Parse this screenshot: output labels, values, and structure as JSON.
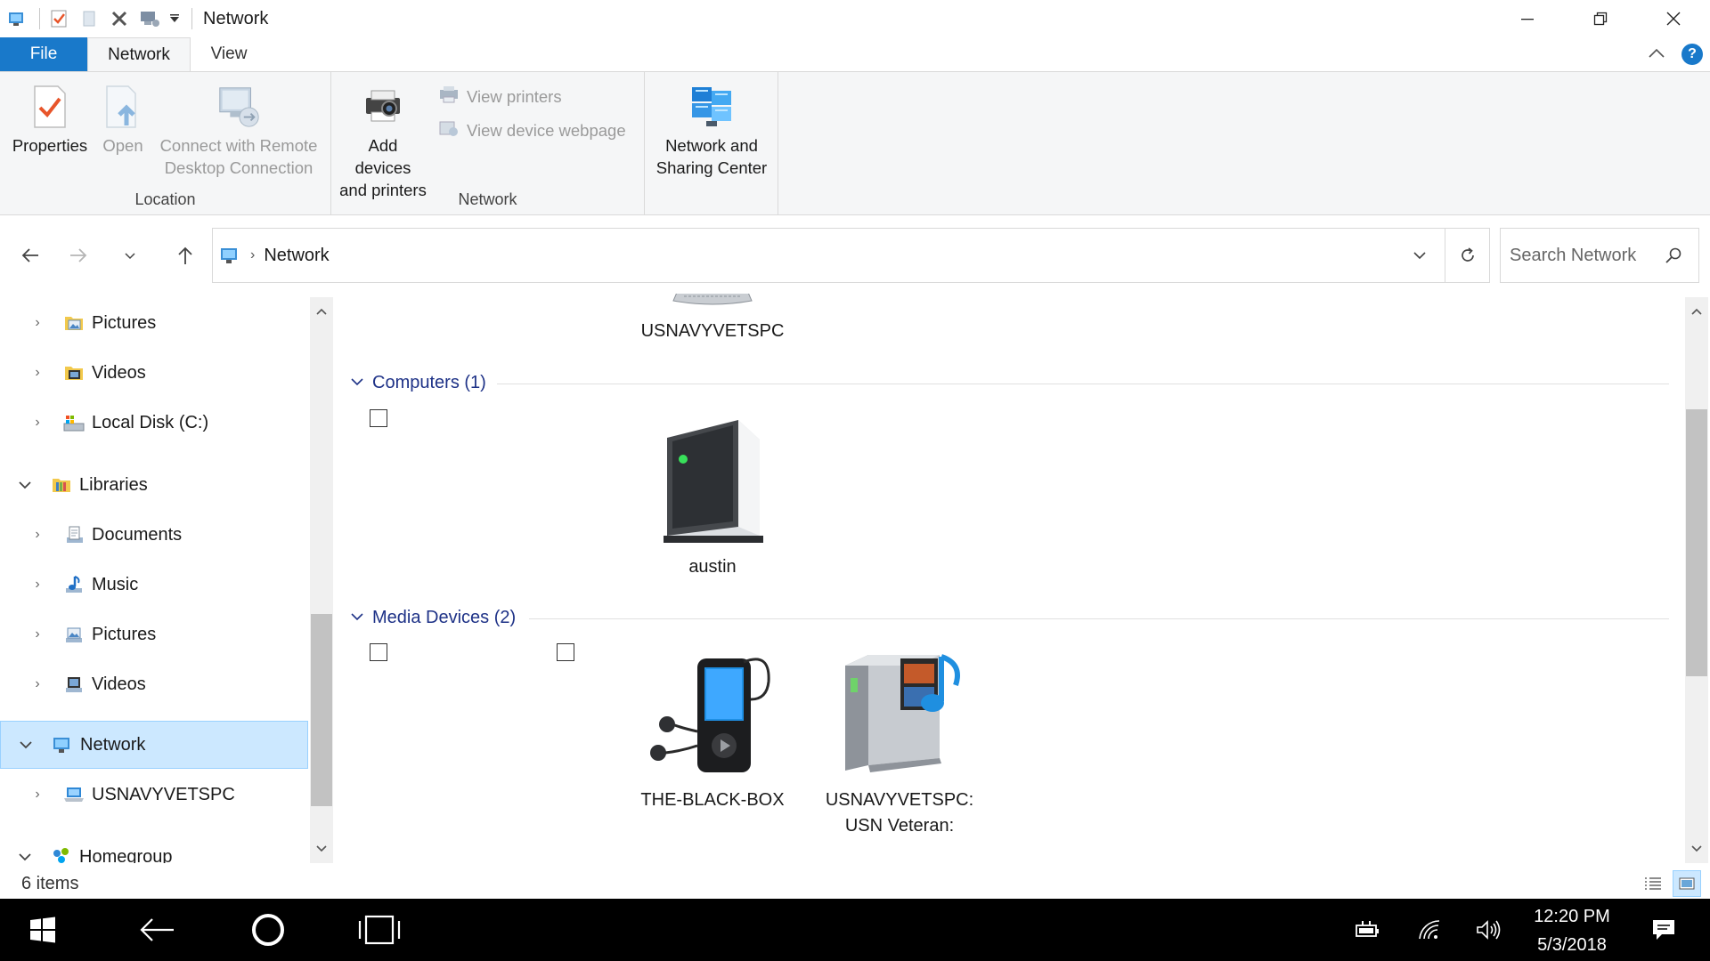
{
  "window": {
    "title": "Network"
  },
  "ribbon_tabs": {
    "file": "File",
    "network": "Network",
    "view": "View"
  },
  "ribbon": {
    "location_group": {
      "label": "Location",
      "properties": "Properties",
      "open": "Open",
      "remote_line1": "Connect with Remote",
      "remote_line2": "Desktop Connection"
    },
    "network_group": {
      "label": "Network",
      "add_devices_line1": "Add devices",
      "add_devices_line2": "and printers",
      "view_printers": "View printers",
      "view_device_webpage": "View device webpage"
    },
    "center_group": {
      "nsc_line1": "Network and",
      "nsc_line2": "Sharing Center"
    }
  },
  "address": {
    "crumb": "Network",
    "search_placeholder": "Search Network"
  },
  "nav": {
    "items": [
      {
        "label": "Pictures"
      },
      {
        "label": "Videos"
      },
      {
        "label": "Local Disk (C:)"
      },
      {
        "label": "Libraries"
      },
      {
        "label": "Documents"
      },
      {
        "label": "Music"
      },
      {
        "label": "Pictures"
      },
      {
        "label": "Videos"
      },
      {
        "label": "Network"
      },
      {
        "label": "USNAVYVETSPC"
      },
      {
        "label": "Homegroup"
      }
    ]
  },
  "content": {
    "partial_item": "USNAVYVETSPC",
    "groups": [
      {
        "header": "Computers (1)",
        "items": [
          {
            "name": "austin",
            "icon": "computer-tower-icon"
          }
        ]
      },
      {
        "header": "Media Devices (2)",
        "items": [
          {
            "name": "THE-BLACK-BOX",
            "icon": "media-player-icon"
          },
          {
            "name_line1": "USNAVYVETSPC:",
            "name_line2": "USN Veteran:",
            "icon": "media-server-icon"
          }
        ]
      }
    ]
  },
  "status": {
    "count": "6 items"
  },
  "taskbar": {
    "time": "12:20 PM",
    "date": "5/3/2018"
  },
  "colors": {
    "accent": "#1979ca",
    "selection": "#cce8ff",
    "group_header": "#1e3287",
    "taskbar": "#000000"
  }
}
